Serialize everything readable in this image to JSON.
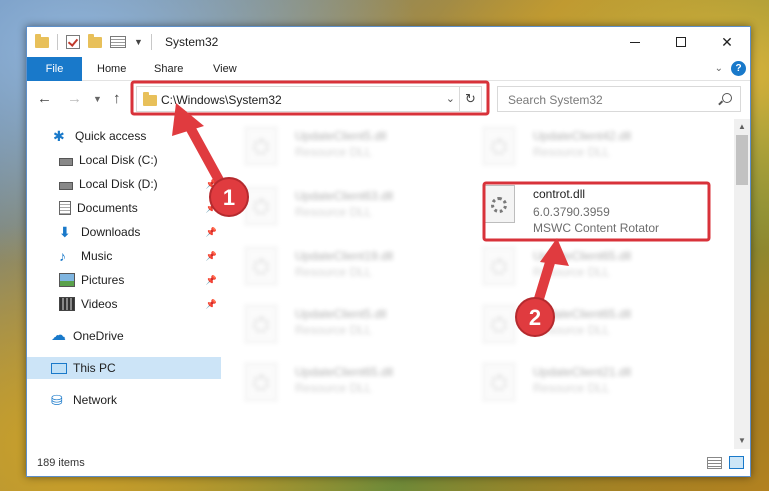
{
  "window": {
    "title": "System32",
    "tabs": [
      "File",
      "Home",
      "Share",
      "View"
    ]
  },
  "nav": {
    "address": "C:\\Windows\\System32",
    "search_placeholder": "Search System32"
  },
  "sidebar": {
    "items": [
      {
        "label": "Quick access",
        "icon": "star-icon"
      },
      {
        "label": "Local Disk (C:)",
        "icon": "disk-icon"
      },
      {
        "label": "Local Disk (D:)",
        "icon": "disk-icon"
      },
      {
        "label": "Documents",
        "icon": "document-icon"
      },
      {
        "label": "Downloads",
        "icon": "download-icon"
      },
      {
        "label": "Music",
        "icon": "music-icon"
      },
      {
        "label": "Pictures",
        "icon": "pictures-icon"
      },
      {
        "label": "Videos",
        "icon": "videos-icon"
      },
      {
        "label": "OneDrive",
        "icon": "cloud-icon"
      },
      {
        "label": "This PC",
        "icon": "computer-icon"
      },
      {
        "label": "Network",
        "icon": "network-icon"
      }
    ]
  },
  "files": {
    "highlight": {
      "name": "controt.dll",
      "version": "6.0.3790.3959",
      "description": "MSWC Content Rotator"
    },
    "blurred": [
      {
        "name": "UpdateClient5.dll",
        "desc": "Resource DLL"
      },
      {
        "name": "UpdateClient42.dll",
        "desc": "Resource DLL"
      },
      {
        "name": "UpdateClient63.dll",
        "desc": "Resource DLL"
      },
      {
        "name": "UpdateClient19.dll",
        "desc": "Resource DLL"
      },
      {
        "name": "UpdateClient65.dll",
        "desc": "Resource DLL"
      },
      {
        "name": "UpdateClient5.dll",
        "desc": "Resource DLL"
      },
      {
        "name": "UpdateClient65.dll",
        "desc": "Resource DLL"
      },
      {
        "name": "UpdateClient65.dll",
        "desc": "Resource DLL"
      },
      {
        "name": "UpdateClient21.dll",
        "desc": "Resource DLL"
      }
    ]
  },
  "status": {
    "item_count": "189 items"
  },
  "annotations": {
    "step1": "1",
    "step2": "2",
    "color": "#d8323a"
  },
  "colors": {
    "accent": "#1979ca",
    "selection": "#cce4f7"
  }
}
